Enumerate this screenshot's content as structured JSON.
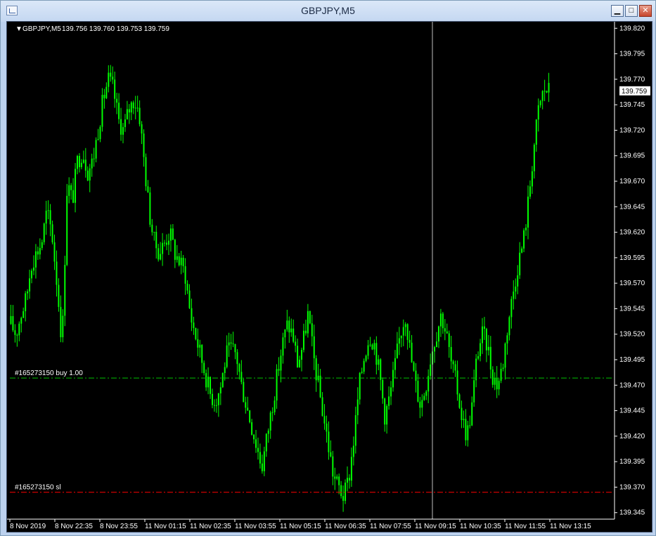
{
  "window": {
    "title": "GBPJPY,M5",
    "minimize_glyph": "▁",
    "maximize_glyph": "□",
    "close_glyph": "✕"
  },
  "chart_header": {
    "symbol": "GBPJPY,M5",
    "ohlc": "139.756 139.760 139.753 139.759"
  },
  "colors": {
    "background": "#000000",
    "candle": "#00ff00",
    "order_line": "#00c000",
    "stop_line": "#ff0000",
    "crosshair": "#c0c0c0",
    "axis_text": "#ffffff"
  },
  "current_price_label": "139.759",
  "order_lines": {
    "buy_label": "#165273150 buy 1.00",
    "sl_label": "#165273150 sl"
  },
  "chart_data": {
    "type": "candlestick",
    "symbol": "GBPJPY",
    "timeframe": "M5",
    "last_bar": {
      "open": 139.756,
      "high": 139.76,
      "low": 139.753,
      "close": 139.759
    },
    "ylim": [
      139.34,
      139.825
    ],
    "y_ticks": [
      "139.820",
      "139.795",
      "139.770",
      "139.745",
      "139.720",
      "139.695",
      "139.670",
      "139.645",
      "139.620",
      "139.595",
      "139.570",
      "139.545",
      "139.520",
      "139.495",
      "139.470",
      "139.445",
      "139.420",
      "139.395",
      "139.370",
      "139.345"
    ],
    "x_ticks": [
      "8 Nov 2019",
      "8 Nov 22:35",
      "8 Nov 23:55",
      "11 Nov 01:15",
      "11 Nov 02:35",
      "11 Nov 03:55",
      "11 Nov 05:15",
      "11 Nov 06:35",
      "11 Nov 07:55",
      "11 Nov 09:15",
      "11 Nov 10:35",
      "11 Nov 11:55",
      "11 Nov 13:15"
    ],
    "buy_price": 139.477,
    "sl_price": 139.365,
    "price_path": [
      139.53,
      139.52,
      139.54,
      139.555,
      139.59,
      139.6,
      139.61,
      139.64,
      139.62,
      139.57,
      139.51,
      139.67,
      139.65,
      139.69,
      139.7,
      139.68,
      139.69,
      139.72,
      139.75,
      139.77,
      139.76,
      139.73,
      139.72,
      139.74,
      139.75,
      139.74,
      139.69,
      139.64,
      139.61,
      139.6,
      139.61,
      139.62,
      139.6,
      139.59,
      139.58,
      139.54,
      139.52,
      139.5,
      139.48,
      139.46,
      139.455,
      139.47,
      139.5,
      139.505,
      139.5,
      139.47,
      139.45,
      139.43,
      139.41,
      139.39,
      139.42,
      139.45,
      139.48,
      139.51,
      139.53,
      139.52,
      139.49,
      139.51,
      139.54,
      139.5,
      139.47,
      139.44,
      139.41,
      139.38,
      139.37,
      139.36,
      139.38,
      139.42,
      139.47,
      139.5,
      139.52,
      139.51,
      139.48,
      139.44,
      139.46,
      139.49,
      139.52,
      139.54,
      139.5,
      139.47,
      139.45,
      139.47,
      139.5,
      139.52,
      139.54,
      139.52,
      139.49,
      139.47,
      139.44,
      139.42,
      139.45,
      139.5,
      139.52,
      139.51,
      139.48,
      139.47,
      139.49,
      139.53,
      139.56,
      139.59,
      139.61,
      139.65,
      139.7,
      139.74,
      139.76,
      139.759
    ],
    "crosshair_time": "11 Nov 09:15"
  }
}
